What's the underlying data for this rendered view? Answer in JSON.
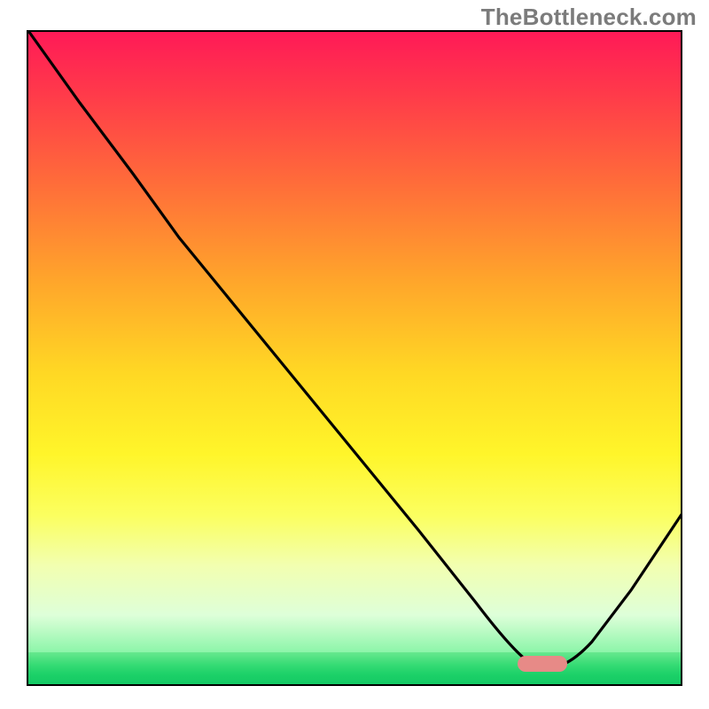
{
  "watermark": "TheBottleneck.com",
  "chart_data": {
    "type": "line",
    "title": "",
    "xlabel": "",
    "ylabel": "",
    "x": [
      0.0,
      0.06,
      0.14,
      0.22,
      0.34,
      0.46,
      0.58,
      0.68,
      0.74,
      0.78,
      0.82,
      0.88,
      1.0
    ],
    "y": [
      1.0,
      0.9,
      0.78,
      0.7,
      0.56,
      0.42,
      0.28,
      0.14,
      0.06,
      0.03,
      0.03,
      0.06,
      0.28
    ],
    "xlim": [
      0,
      1
    ],
    "ylim": [
      0,
      1
    ],
    "marker": {
      "x": 0.79,
      "y": 0.03
    },
    "gradient": {
      "top": "#ff1a57",
      "mid": "#fff52a",
      "bottom": "#14c964"
    },
    "note": "Axes carry no visible tick labels; x/y are normalized fractions of the plot area. The black curve descends from top-left, reaches a minimum near x≈0.8, then rises toward the right edge."
  }
}
